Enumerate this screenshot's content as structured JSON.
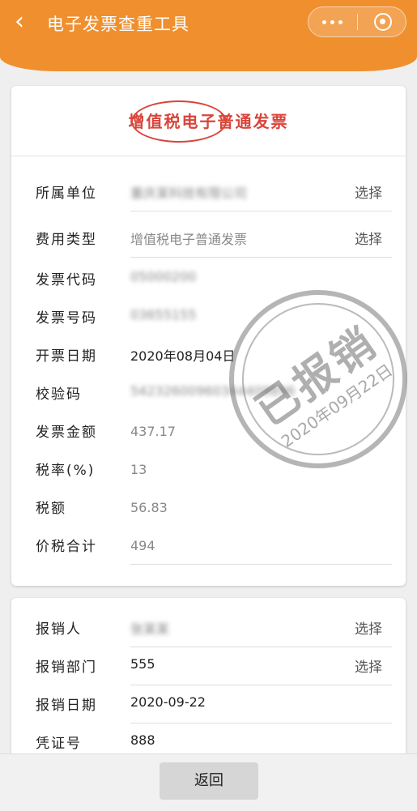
{
  "header": {
    "title": "电子发票查重工具"
  },
  "card": {
    "title": "增值税电子普通发票",
    "rows": [
      {
        "label": "所属单位",
        "value": "重庆某科技有限公司",
        "choose": "选择"
      },
      {
        "label": "费用类型",
        "value": "增值税电子普通发票",
        "choose": "选择"
      },
      {
        "label": "发票代码",
        "value": "05000200"
      },
      {
        "label": "发票号码",
        "value": "03655155"
      },
      {
        "label": "开票日期",
        "value": "2020年08月04日"
      },
      {
        "label": "校验码",
        "value": "54232600960344409896"
      },
      {
        "label": "发票金额",
        "value": "437.17"
      },
      {
        "label": "税率(%)",
        "value": "13"
      },
      {
        "label": "税额",
        "value": "56.83"
      },
      {
        "label": "价税合计",
        "value": "494"
      }
    ],
    "stamp": {
      "text": "已报销",
      "date": "2020年09月22日"
    }
  },
  "card2": {
    "rows": [
      {
        "label": "报销人",
        "value": "张某某",
        "choose": "选择"
      },
      {
        "label": "报销部门",
        "value": "555",
        "choose": "选择"
      },
      {
        "label": "报销日期",
        "value": "2020-09-22"
      },
      {
        "label": "凭证号",
        "value": "888"
      }
    ]
  },
  "footer": {
    "return_label": "返回"
  }
}
